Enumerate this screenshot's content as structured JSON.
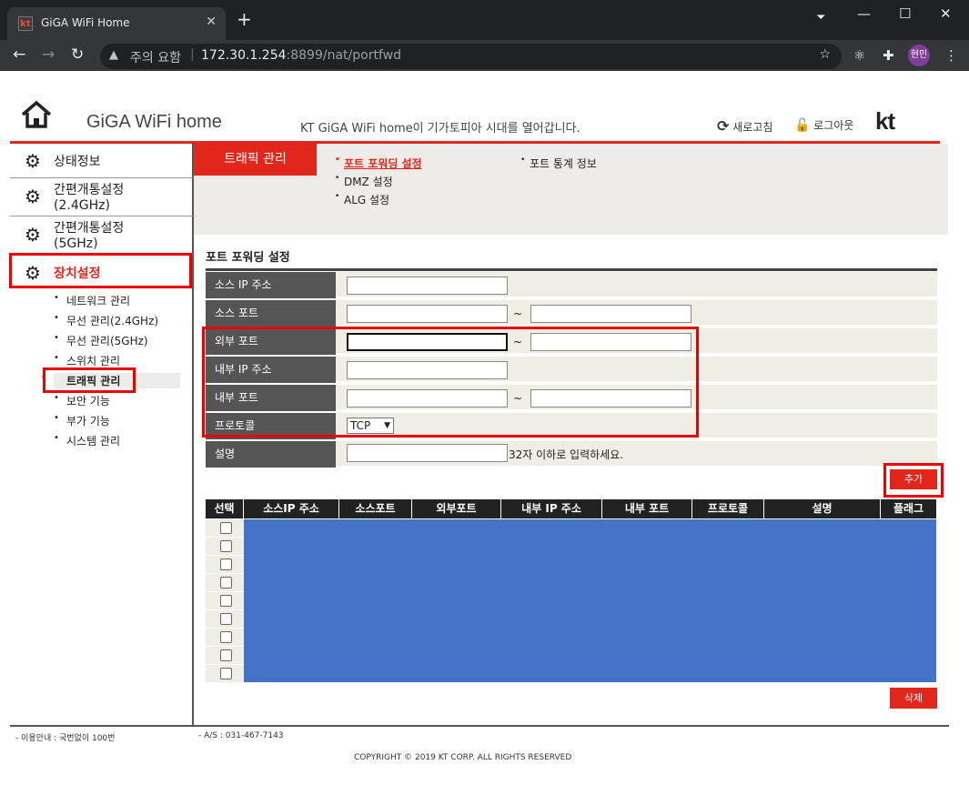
{
  "browser": {
    "tab_title": "GiGA WiFi Home",
    "tab_favicon": "kt",
    "new_tab": "+",
    "security_label": "주의 요함",
    "url_host": "172.30.1.254",
    "url_rest": ":8899/nat/portfwd",
    "profile": "현민"
  },
  "header": {
    "site_title": "GiGA WiFi home",
    "tagline": "KT GiGA WiFi home이 기가토피아 시대를 열어갑니다.",
    "refresh": "새로고침",
    "logout": "로그아웃",
    "logo": "kt"
  },
  "sidebar": {
    "items": [
      {
        "label": "상태정보"
      },
      {
        "label": "간편개통설정\n(2.4GHz)"
      },
      {
        "label": "간편개통설정\n(5GHz)"
      },
      {
        "label": "장치설정"
      }
    ],
    "subitems": [
      "네트워크 관리",
      "무선 관리(2.4GHz)",
      "무선 관리(5GHz)",
      "스위치 관리",
      "트래픽 관리",
      "보안 기능",
      "부가 기능",
      "시스템 관리"
    ]
  },
  "topnav": {
    "tab": "트래픽 관리",
    "links": [
      "포트 포워딩 설정",
      "DMZ 설정",
      "ALG 설정",
      "포트 통계 정보"
    ]
  },
  "form": {
    "title": "포트 포워딩 설정",
    "rows": [
      "소스 IP 주소",
      "소스 포트",
      "외부 포트",
      "내부 IP 주소",
      "내부 포트",
      "프로토콜",
      "설명"
    ],
    "tilde": "~",
    "protocol": "TCP",
    "desc_hint": "32자 이하로 입력하세요.",
    "add": "추가"
  },
  "table": {
    "headers": [
      "선택",
      "소스IP 주소",
      "소스포트",
      "외부포트",
      "내부 IP 주소",
      "내부 포트",
      "프로토콜",
      "설명",
      "플래그"
    ],
    "delete": "삭제"
  },
  "footer": {
    "left": "- 이용안내 : 국번없이 100번",
    "as": "- A/S : 031-467-7143",
    "copyright": "COPYRIGHT © 2019 KT CORP. ALL RIGHTS RESERVED"
  },
  "colors": {
    "accent": "#e3261b",
    "table_blue": "#4472c4"
  }
}
